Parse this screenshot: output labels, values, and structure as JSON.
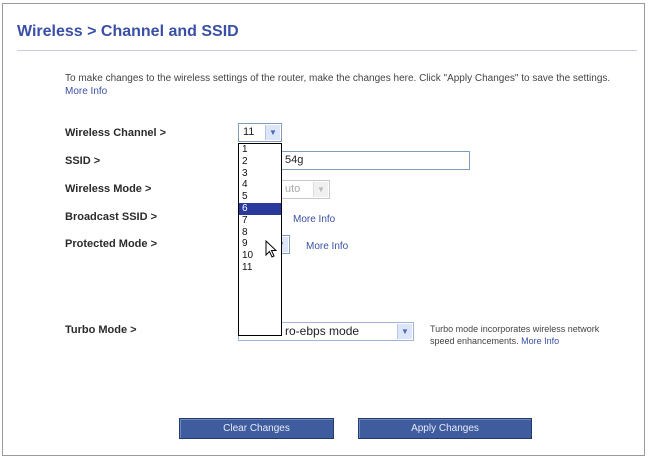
{
  "title": "Wireless > Channel and SSID",
  "intro": {
    "text": "To make changes to the wireless settings of the router, make the changes here. Click \"Apply Changes\" to save the settings.",
    "more_info": "More Info"
  },
  "fields": {
    "channel": {
      "label": "Wireless Channel >",
      "value": "11"
    },
    "ssid": {
      "label": "SSID >",
      "value": "54g"
    },
    "mode": {
      "label": "Wireless Mode >",
      "value": "uto"
    },
    "broadcast": {
      "label": "Broadcast SSID >",
      "more_info": "More Info"
    },
    "protected": {
      "label": "Protected Mode >",
      "more_info": "More Info"
    },
    "turbo": {
      "label": "Turbo Mode >",
      "value": "ro-ebps mode",
      "description": "Turbo mode incorporates wireless network speed enhancements.",
      "more_info": "More Info"
    }
  },
  "channel_dropdown": {
    "options": [
      "1",
      "2",
      "3",
      "4",
      "5",
      "6",
      "7",
      "8",
      "9",
      "10",
      "11"
    ],
    "highlighted_index": 5
  },
  "buttons": {
    "clear": "Clear Changes",
    "apply": "Apply Changes"
  },
  "colors": {
    "title": "#3a4fa6",
    "link": "#3a4fa6",
    "button": "#3e5c9e",
    "highlight": "#2a3a9c"
  }
}
